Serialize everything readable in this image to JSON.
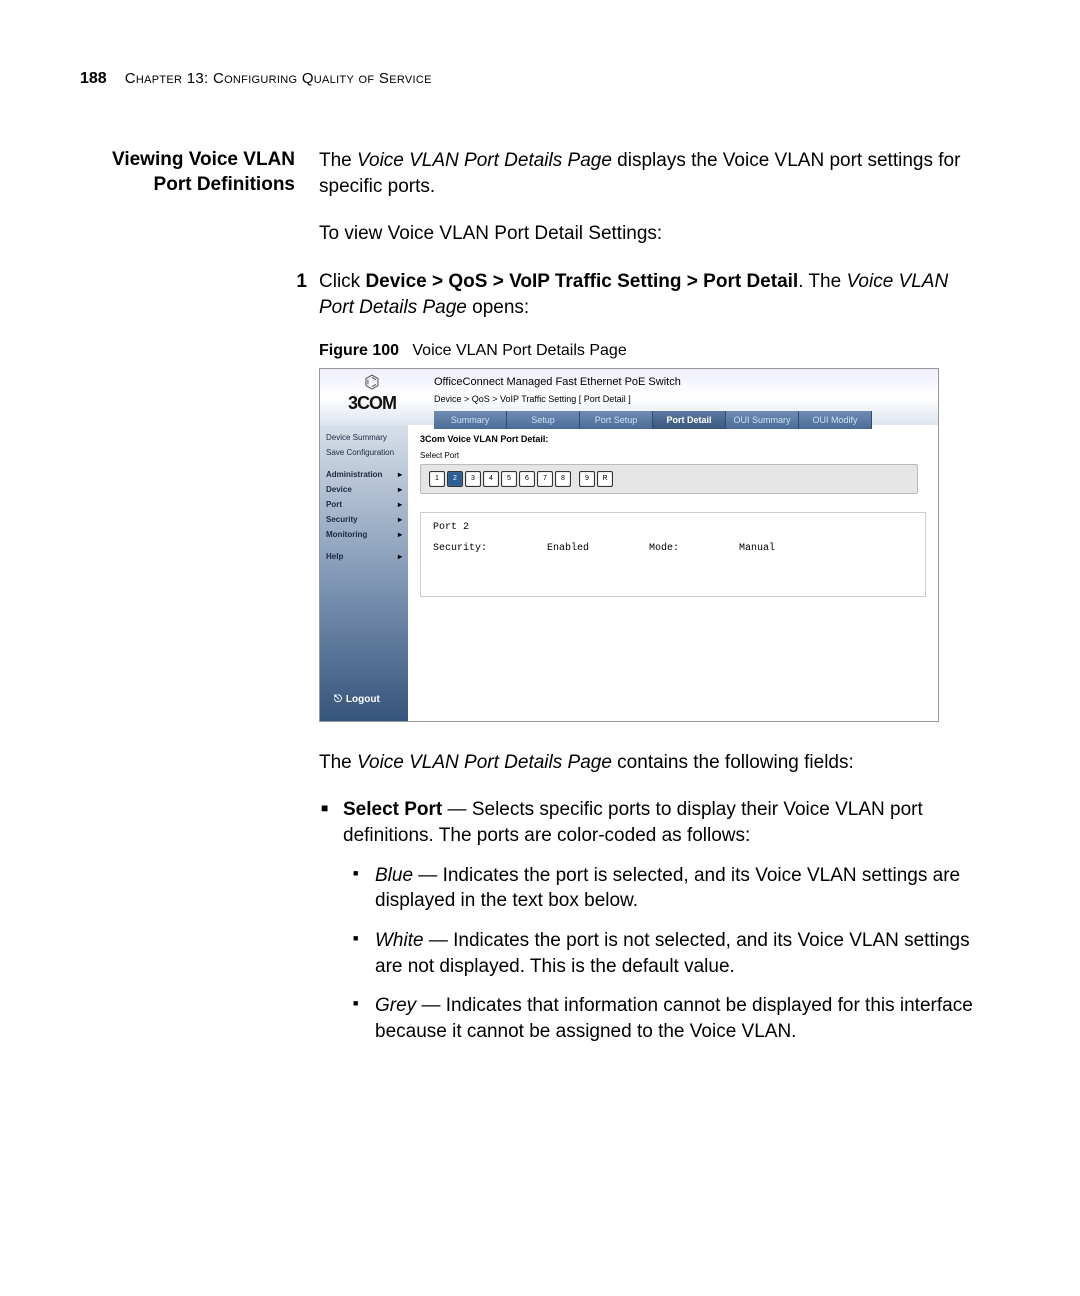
{
  "page_number": "188",
  "chapter_line": "Chapter 13: Configuring Quality of Service",
  "section_title_l1": "Viewing Voice VLAN",
  "section_title_l2": "Port Definitions",
  "intro_sentence_pre": "The ",
  "intro_page_name": "Voice VLAN Port Details Page",
  "intro_sentence_post": " displays the Voice VLAN port settings for specific ports.",
  "instr_line": "To view Voice VLAN Port Detail Settings:",
  "step_number": "1",
  "step_pre": "Click ",
  "step_path": "Device > QoS > VoIP Traffic Setting > Port Detail",
  "step_mid": ". The ",
  "step_page": "Voice VLAN Port Details Page",
  "step_post": " opens:",
  "figure_label": "Figure 100",
  "figure_caption": "Voice VLAN Port Details Page",
  "screenshot": {
    "logo_text": "3COM",
    "device_title": "OfficeConnect Managed Fast Ethernet PoE Switch",
    "breadcrumb": "Device > QoS > VoIP Traffic Setting [ Port Detail ]",
    "tabs": [
      "Summary",
      "Setup",
      "Port Setup",
      "Port Detail",
      "OUI Summary",
      "OUI Modify"
    ],
    "active_tab_index": 3,
    "sidebar_top": [
      "Device Summary",
      "Save Configuration"
    ],
    "sidebar_nav": [
      "Administration",
      "Device",
      "Port",
      "Security",
      "Monitoring"
    ],
    "sidebar_help": "Help",
    "logout": "Logout",
    "content_title": "3Com Voice VLAN Port Detail:",
    "select_port_label": "Select Port",
    "ports": [
      "1",
      "2",
      "3",
      "4",
      "5",
      "6",
      "7",
      "8"
    ],
    "extra_ports": [
      "9",
      "R"
    ],
    "selected_port_index": 1,
    "detail_port_name": "Port 2",
    "detail_security_label": "Security:",
    "detail_security_value": "Enabled",
    "detail_mode_label": "Mode:",
    "detail_mode_value": "Manual"
  },
  "after_fig_sentence_pre": "The ",
  "after_fig_page_name": "Voice VLAN Port Details Page",
  "after_fig_sentence_post": " contains the following fields:",
  "field_select_port_label": "Select Port",
  "field_select_port_desc": " — Selects specific ports to display their Voice VLAN port definitions. The ports are color-coded as follows:",
  "color_blue_label": "Blue",
  "color_blue_desc": " — Indicates the port is selected, and its Voice VLAN settings are displayed in the text box below.",
  "color_white_label": "White",
  "color_white_desc": " — Indicates the port is not selected, and its Voice VLAN settings are not displayed. This is the default value.",
  "color_grey_label": "Grey",
  "color_grey_desc": " — Indicates that information cannot be displayed for this interface because it cannot be assigned to the Voice VLAN."
}
